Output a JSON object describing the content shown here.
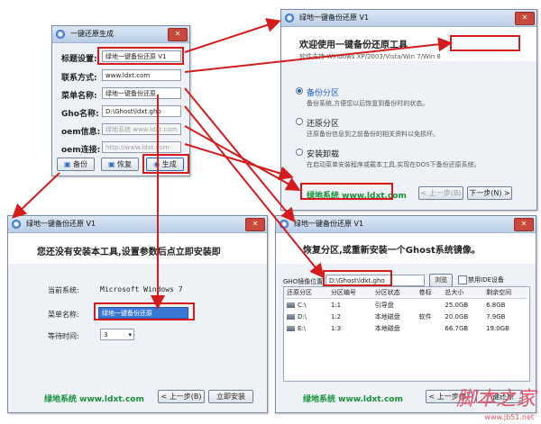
{
  "small_window": {
    "title": "一键还原生成",
    "fields": [
      {
        "label": "标题设置:",
        "value": "绿地一键备份还原 V1"
      },
      {
        "label": "联系方式:",
        "value": "www.ldxt.com"
      },
      {
        "label": "菜单名称:",
        "value": "绿地一键备份还原"
      },
      {
        "label": "Gho名称:",
        "value": "D:\\Ghost\\ldxt.gho"
      },
      {
        "label": "oem信息:",
        "value": "绿地系统 www.ldxt.com"
      },
      {
        "label": "oem连接:",
        "value": "http://www.ldxt.com"
      }
    ],
    "buttons": {
      "backup": "备份",
      "restore": "恢复",
      "generate": "生成"
    }
  },
  "welcome_window": {
    "title": "绿地一键备份还原 V1",
    "heading": "欢迎使用一键备份还原工具",
    "support": "软件支持 Windows XP/2003/Vista/Win 7/Win 8",
    "options": [
      {
        "title": "备份分区",
        "desc": "备份系统,方便您以后恢复到备份时的状态。",
        "selected": true
      },
      {
        "title": "还原分区",
        "desc": "还原备份信息到之前备份的相关资料以免损坏。",
        "selected": false
      },
      {
        "title": "安装卸载",
        "desc": "在启动菜单安装程序或载本工具,实现在DOS下备份还原系统。",
        "selected": false
      }
    ],
    "brand": "绿地系统 www.ldxt.com",
    "prev": "< 上一步(B)",
    "next": "下一步(N) >"
  },
  "install_window": {
    "title": "绿地一键备份还原 V1",
    "heading": "您还没有安装本工具,设置参数后点立即安装即",
    "system_label": "当前系统:",
    "system_value": "Microsoft Windows 7",
    "menu_label": "菜单名称:",
    "menu_value": "绿地一键备份还原",
    "wait_label": "等待时间:",
    "wait_value": "3",
    "brand": "绿地系统 www.ldxt.com",
    "prev": "< 上一步(B)",
    "install": "立即安装"
  },
  "restore_window": {
    "title": "绿地一键备份还原 V1",
    "heading": "恢复分区,或重新安装一个Ghost系统镜像。",
    "gho_label": "GHO镜像位置",
    "gho_value": "D:\\Ghost\\ldxt.gho",
    "browse": "浏览",
    "ide_checkbox": "禁用IDE设备",
    "columns": [
      "还原分区",
      "分区编号",
      "分区状态",
      "卷标",
      "总大小",
      "剩余空间"
    ],
    "rows": [
      [
        "C:\\",
        "1:1",
        "引导盘",
        "",
        "25.0GB",
        "6.8GB"
      ],
      [
        "D:\\",
        "1:2",
        "本地磁盘",
        "软件",
        "20.0GB",
        "7.9GB"
      ],
      [
        "E:\\",
        "1:3",
        "本地磁盘",
        "",
        "66.7GB",
        "19.0GB"
      ]
    ],
    "brand": "绿地系统 www.ldxt.com",
    "prev": "< 上一步(B)",
    "restore": "一键还原"
  },
  "watermark": {
    "title": "脚本之家",
    "url": "www.jb51.net"
  }
}
